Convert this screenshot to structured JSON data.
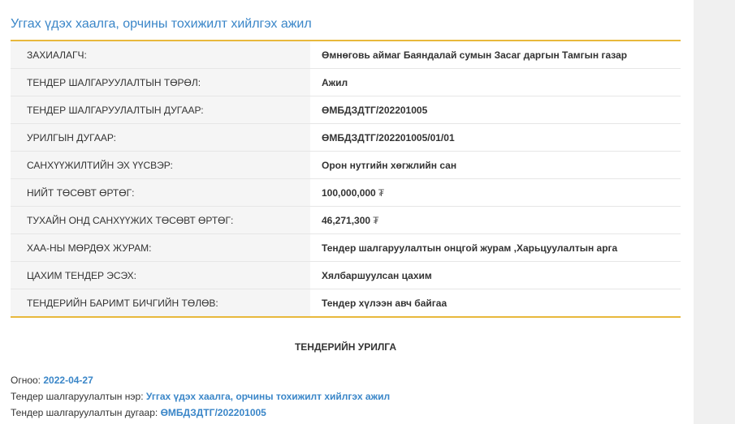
{
  "header": {
    "title": "Уггах үдэх хаалга, орчины тохижилт хийлгэх ажил"
  },
  "details": [
    {
      "label": "ЗАХИАЛАГЧ:",
      "value": "Өмнөговь аймаг Баяндалай сумын Засаг даргын Тамгын газар"
    },
    {
      "label": "ТЕНДЕР ШАЛГАРУУЛАЛТЫН ТӨРӨЛ:",
      "value": "Ажил"
    },
    {
      "label": "ТЕНДЕР ШАЛГАРУУЛАЛТЫН ДУГААР:",
      "value": "ӨМБДЗДТГ/202201005"
    },
    {
      "label": "УРИЛГЫН ДУГААР:",
      "value": "ӨМБДЗДТГ/202201005/01/01"
    },
    {
      "label": "САНХҮҮЖИЛТИЙН ЭХ ҮҮСВЭР:",
      "value": "Орон нутгийн хөгжлийн сан"
    },
    {
      "label": "НИЙТ ТӨСӨВТ ӨРТӨГ:",
      "value": "100,000,000",
      "currency": "₮"
    },
    {
      "label": "ТУХАЙН ОНД САНХҮҮЖИХ ТӨСӨВТ ӨРТӨГ:",
      "value": "46,271,300",
      "currency": "₮"
    },
    {
      "label": "ХАА-НЫ МӨРДӨХ ЖУРАМ:",
      "value": "Тендер шалгаруулалтын онцгой журам ,Харьцуулалтын арга"
    },
    {
      "label": "ЦАХИМ ТЕНДЕР ЭСЭХ:",
      "value": "Хялбаршуулсан цахим"
    },
    {
      "label": "ТЕНДЕРИЙН БАРИМТ БИЧГИЙН ТӨЛӨВ:",
      "value": "Тендер хүлээн авч байгаа"
    }
  ],
  "invitation": {
    "section_title": "ТЕНДЕРИЙН УРИЛГА",
    "date_label": "Огноо:",
    "date_value": "2022-04-27",
    "name_label": "Тендер шалгаруулалтын нэр:",
    "name_value": "Уггах үдэх хаалга, орчины тохижилт хийлгэх ажил",
    "number_label": "Тендер шалгаруулалтын дугаар:",
    "number_value": "ӨМБДЗДТГ/202201005"
  },
  "colors": {
    "title_blue": "#3a86c8",
    "accent_gold": "#e8b83c",
    "label_bg": "#f5f5f5",
    "side_panel": "#f0f0f0"
  }
}
